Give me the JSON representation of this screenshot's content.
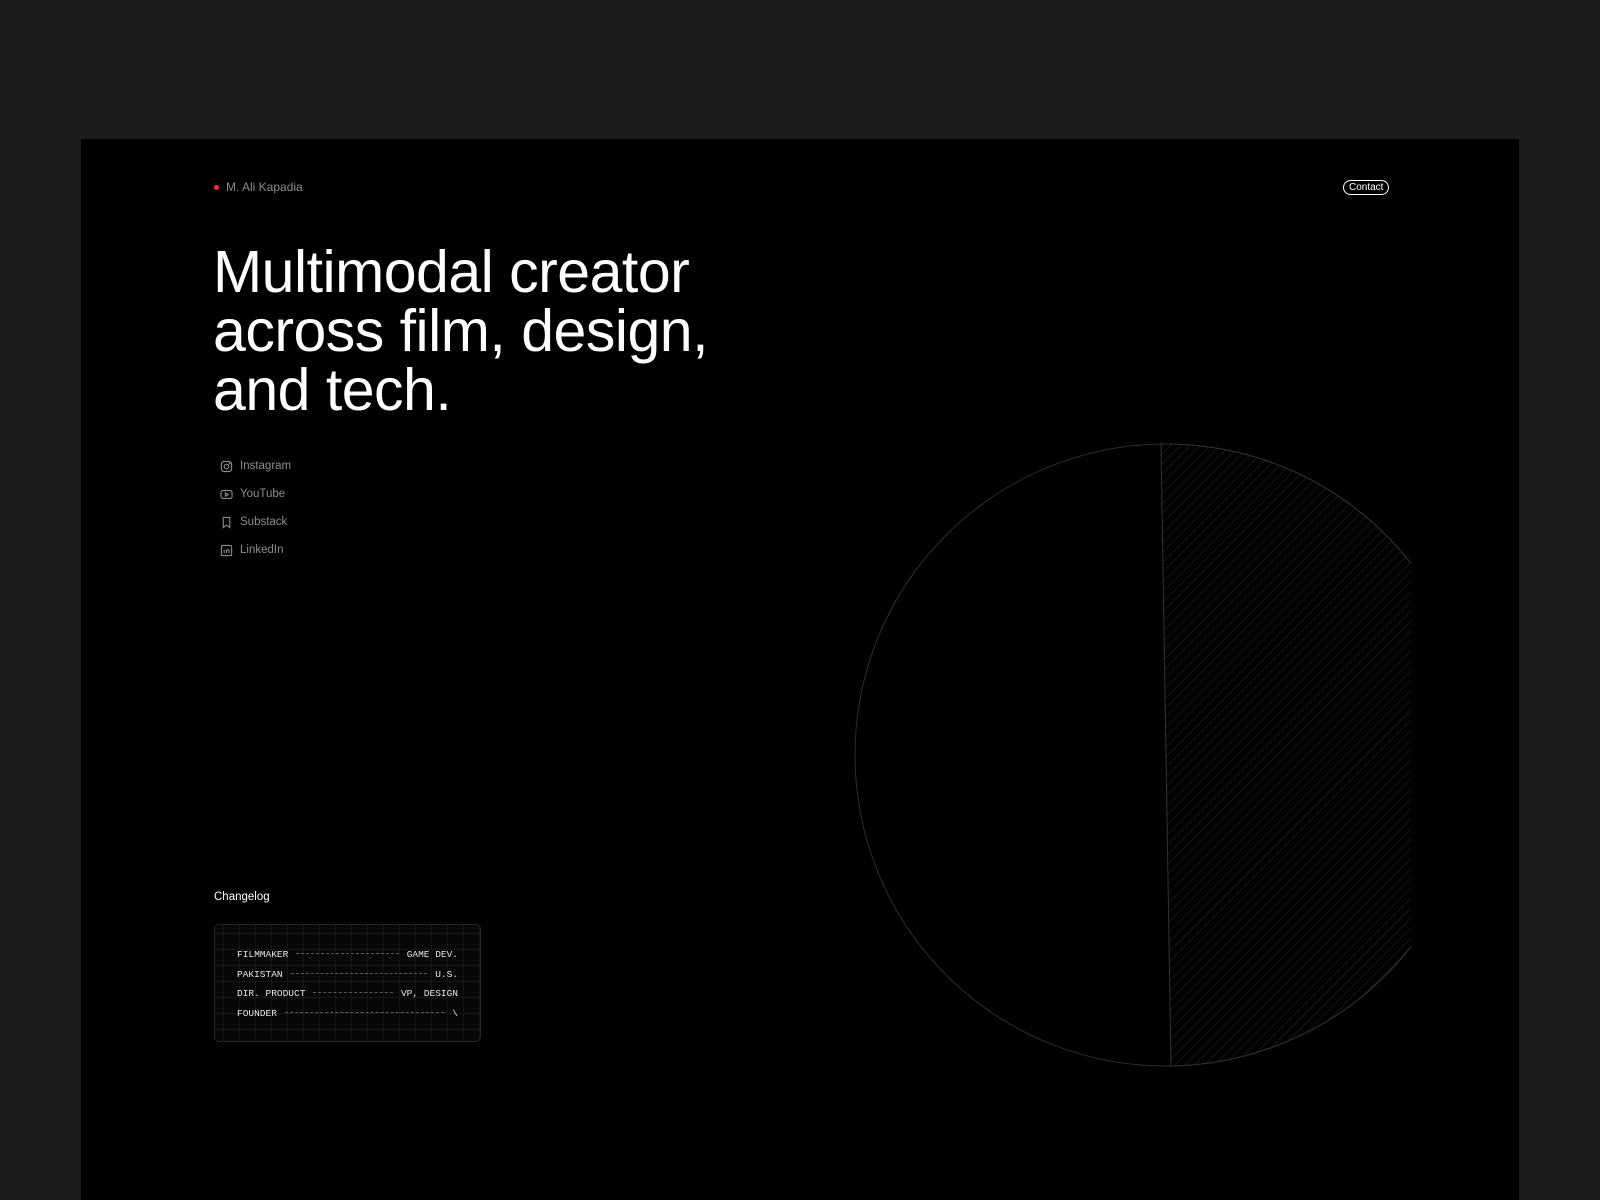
{
  "header": {
    "brand_name": "M. Ali Kapadia",
    "contact_label": "Contact",
    "accent_color": "#ff2d3d"
  },
  "hero": {
    "headline_lines": [
      "Multimodal creator",
      "across film, design,",
      "and tech."
    ]
  },
  "social_links": [
    {
      "label": "Instagram",
      "icon": "instagram-icon"
    },
    {
      "label": "YouTube",
      "icon": "youtube-icon"
    },
    {
      "label": "Substack",
      "icon": "bookmark-icon"
    },
    {
      "label": "LinkedIn",
      "icon": "linkedin-icon"
    }
  ],
  "changelog": {
    "title": "Changelog",
    "rows": [
      {
        "from": "FILMMAKER",
        "to": "GAME DEV."
      },
      {
        "from": "PAKISTAN",
        "to": "U.S."
      },
      {
        "from": "DIR. PRODUCT",
        "to": "VP, DESIGN"
      },
      {
        "from": "FOUNDER",
        "to": "\\"
      }
    ]
  },
  "graphic": {
    "type": "half-hatched-circle",
    "stroke_color": "#2e2e2e"
  }
}
